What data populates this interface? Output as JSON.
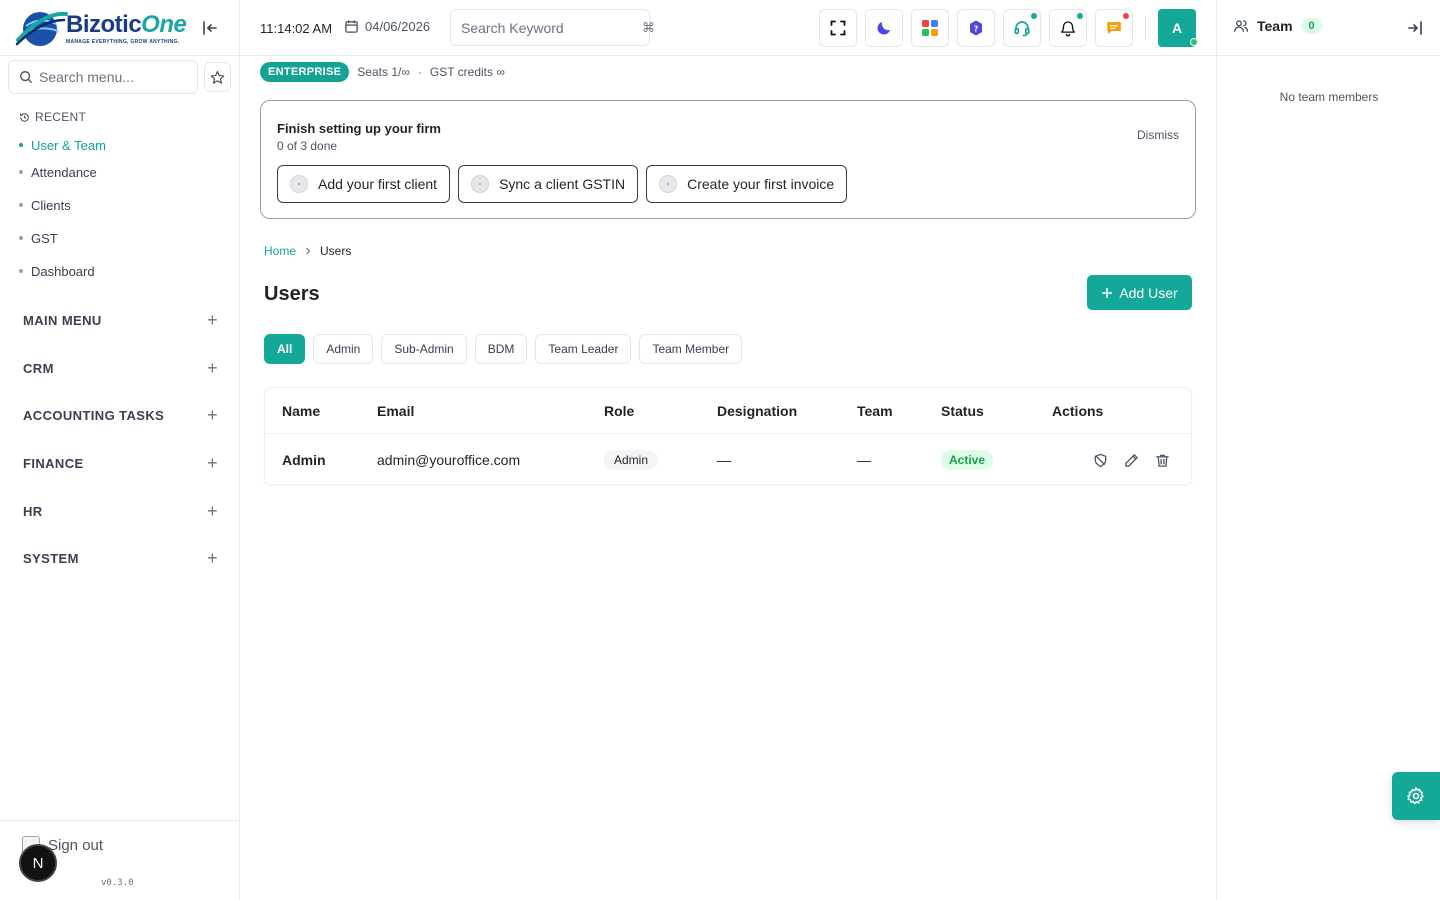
{
  "brand": {
    "name_part1": "Bizotic",
    "name_part2": "One",
    "tagline": "MANAGE EVERYTHING, GROW ANYTHING."
  },
  "sidebar": {
    "search_placeholder": "Search menu...",
    "recent_label": "RECENT",
    "recent": [
      {
        "label": "User & Team",
        "active": true
      },
      {
        "label": "Attendance"
      },
      {
        "label": "Clients"
      },
      {
        "label": "GST"
      },
      {
        "label": "Dashboard"
      }
    ],
    "sections": [
      {
        "label": "MAIN MENU"
      },
      {
        "label": "CRM"
      },
      {
        "label": "ACCOUNTING TASKS"
      },
      {
        "label": "FINANCE"
      },
      {
        "label": "HR"
      },
      {
        "label": "SYSTEM"
      }
    ],
    "signout": "Sign out",
    "badge": "N",
    "version": "v0.3.0"
  },
  "header": {
    "time": "11:14:02 AM",
    "date": "04/06/2026",
    "search_placeholder": "Search Keyword",
    "search_shortcut": "⌘",
    "avatar_initial": "A"
  },
  "plan": {
    "tier": "ENTERPRISE",
    "seats": "Seats 1/∞",
    "sep": "·",
    "gst": "GST credits ∞"
  },
  "setup": {
    "title": "Finish setting up your firm",
    "progress": "0 of 3 done",
    "dismiss": "Dismiss",
    "steps": [
      "Add your first client",
      "Sync a client GSTIN",
      "Create your first invoice"
    ]
  },
  "breadcrumb": {
    "home": "Home",
    "current": "Users"
  },
  "page": {
    "title": "Users",
    "add_button": "Add User"
  },
  "filters": [
    "All",
    "Admin",
    "Sub-Admin",
    "BDM",
    "Team Leader",
    "Team Member"
  ],
  "table": {
    "columns": [
      "Name",
      "Email",
      "Role",
      "Designation",
      "Team",
      "Status",
      "Actions"
    ],
    "rows": [
      {
        "name": "Admin",
        "email": "admin@youroffice.com",
        "role": "Admin",
        "designation": "—",
        "team": "—",
        "status": "Active"
      }
    ]
  },
  "team_panel": {
    "title": "Team",
    "count": "0",
    "empty": "No team members"
  },
  "colors": {
    "accent": "#14a899",
    "active_text": "#12a393",
    "status_bg": "#dcfce7",
    "status_text": "#16a34a"
  }
}
